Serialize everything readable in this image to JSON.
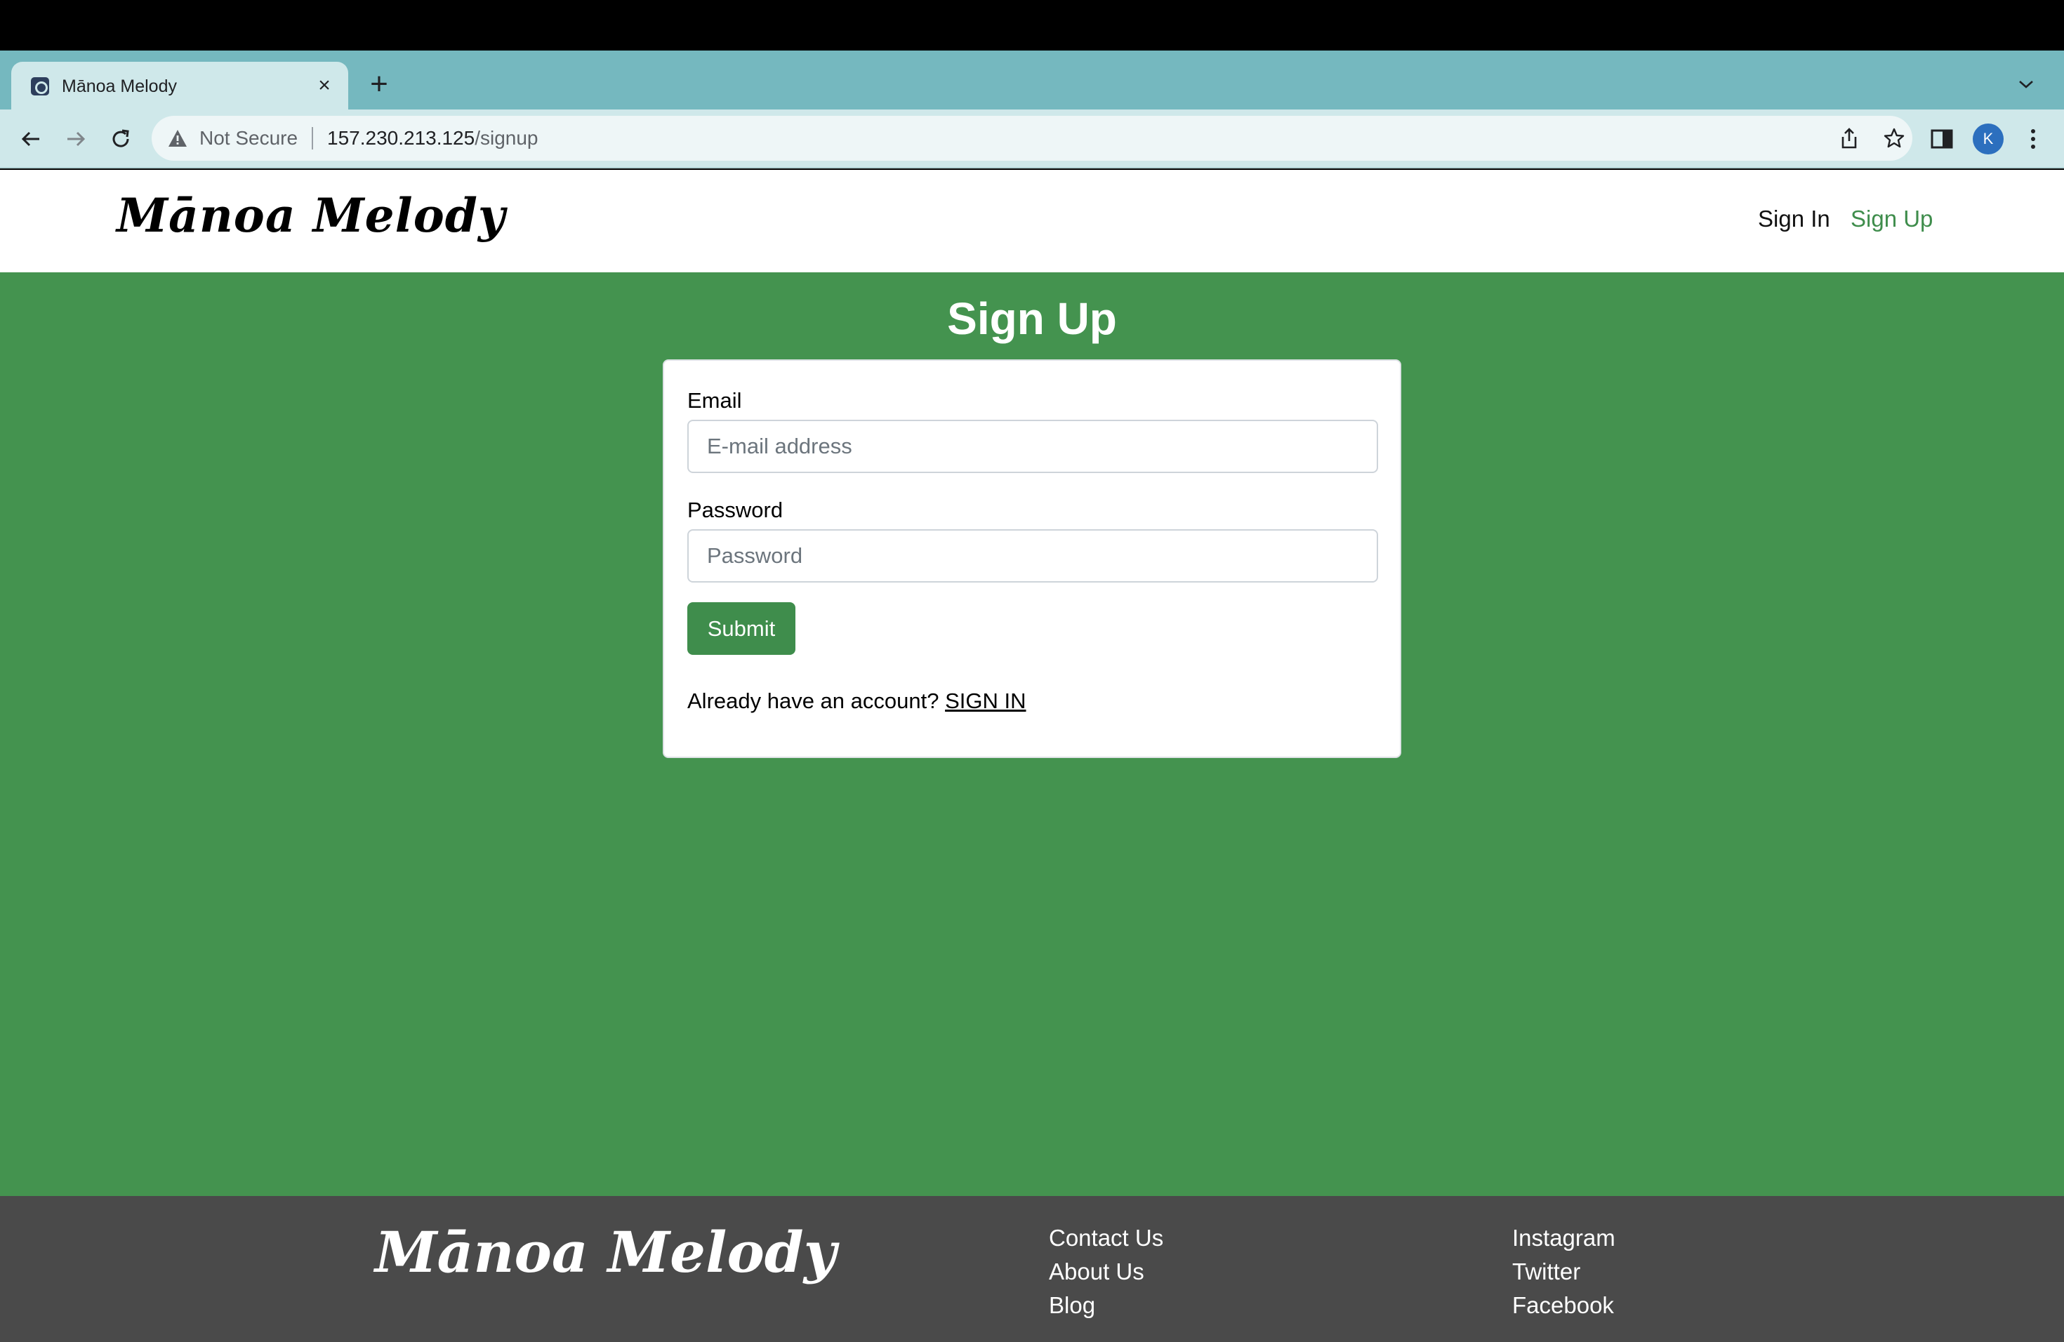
{
  "browser": {
    "tab_title": "Mānoa Melody",
    "tab_close_icon": "close-icon",
    "new_tab_icon": "plus-icon",
    "security_label": "Not Secure",
    "url_host": "157.230.213.125",
    "url_path": "/signup",
    "avatar_letter": "K",
    "accent": "#75b8bf"
  },
  "navbar": {
    "brand": "Mānoa Melody",
    "links": [
      {
        "label": "Sign In"
      },
      {
        "label": "Sign Up"
      }
    ]
  },
  "signup": {
    "heading": "Sign Up",
    "email_label": "Email",
    "email_placeholder": "E-mail address",
    "password_label": "Password",
    "password_placeholder": "Password",
    "submit_label": "Submit",
    "already_text": "Already have an account?",
    "signin_link": "SIGN IN"
  },
  "footer": {
    "brand": "Mānoa Melody",
    "col1": [
      "Contact Us",
      "About Us",
      "Blog"
    ],
    "col2": [
      "Instagram",
      "Twitter",
      "Facebook"
    ]
  },
  "colors": {
    "page_background": "#44934f",
    "button": "#3f8d4c",
    "footer_background": "#4a4a4a"
  }
}
